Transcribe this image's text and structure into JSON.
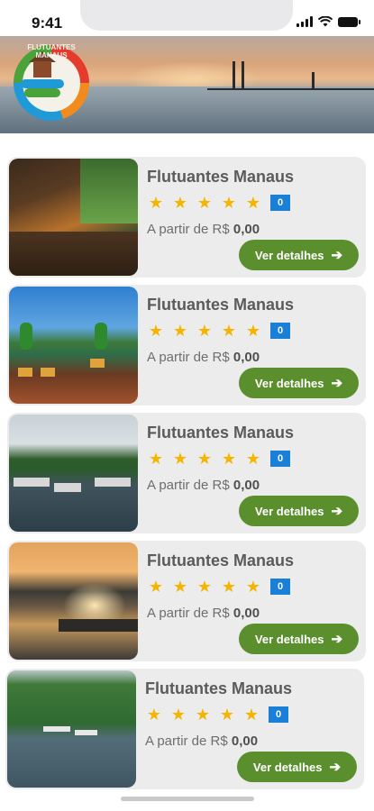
{
  "status_bar": {
    "time": "9:41"
  },
  "hero": {
    "logo_text": "FLUTUANTES MANAUS"
  },
  "listings": [
    {
      "title": "Flutuantes Manaus",
      "rating_count": "0",
      "price_prefix": "A partir de R$ ",
      "price_value": "0,00",
      "button_label": "Ver detalhes"
    },
    {
      "title": "Flutuantes Manaus",
      "rating_count": "0",
      "price_prefix": "A partir de R$ ",
      "price_value": "0,00",
      "button_label": "Ver detalhes"
    },
    {
      "title": "Flutuantes Manaus",
      "rating_count": "0",
      "price_prefix": "A partir de R$ ",
      "price_value": "0,00",
      "button_label": "Ver detalhes"
    },
    {
      "title": "Flutuantes Manaus",
      "rating_count": "0",
      "price_prefix": "A partir de R$ ",
      "price_value": "0,00",
      "button_label": "Ver detalhes"
    },
    {
      "title": "Flutuantes Manaus",
      "rating_count": "0",
      "price_prefix": "A partir de R$ ",
      "price_value": "0,00",
      "button_label": "Ver detalhes"
    }
  ],
  "icons": {
    "star": "star-icon",
    "arrow": "arrow-right-icon"
  },
  "colors": {
    "button": "#5b8f2e",
    "star": "#f4b400",
    "badge": "#1a7fd6",
    "card_bg": "#ececec"
  }
}
